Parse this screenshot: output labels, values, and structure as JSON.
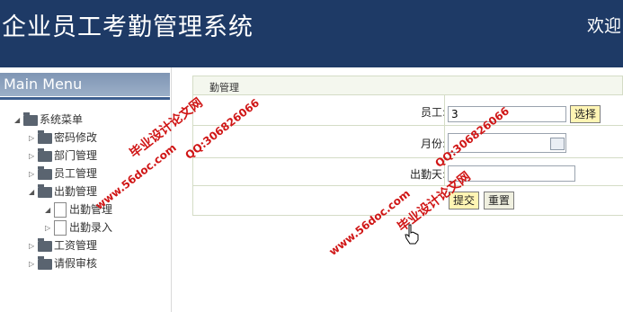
{
  "header": {
    "title": "企业员工考勤管理系统",
    "welcome": "欢迎"
  },
  "sidebar": {
    "menu_title": "Main Menu",
    "root": "系统菜单",
    "items": [
      {
        "label": "密码修改",
        "expanded": false
      },
      {
        "label": "部门管理",
        "expanded": false
      },
      {
        "label": "员工管理",
        "expanded": false
      },
      {
        "label": "出勤管理",
        "expanded": true,
        "children": [
          {
            "label": "出勤管理"
          },
          {
            "label": "出勤录入"
          }
        ]
      },
      {
        "label": "工资管理",
        "expanded": false
      },
      {
        "label": "请假审核",
        "expanded": false
      }
    ]
  },
  "content": {
    "tab_label": "勤管理",
    "form": {
      "employee_label": "员工:",
      "employee_value": "3",
      "select_button": "选择",
      "month_label": "月份:",
      "month_value": "",
      "days_label": "出勤天:",
      "days_value": "",
      "submit_button": "提交",
      "reset_button": "重置"
    }
  },
  "watermarks": [
    "毕业设计论文网",
    "QQ:306826066",
    "www.56doc.com",
    "QQ:306826066",
    "毕业设计论文网",
    "www.56doc.com"
  ]
}
